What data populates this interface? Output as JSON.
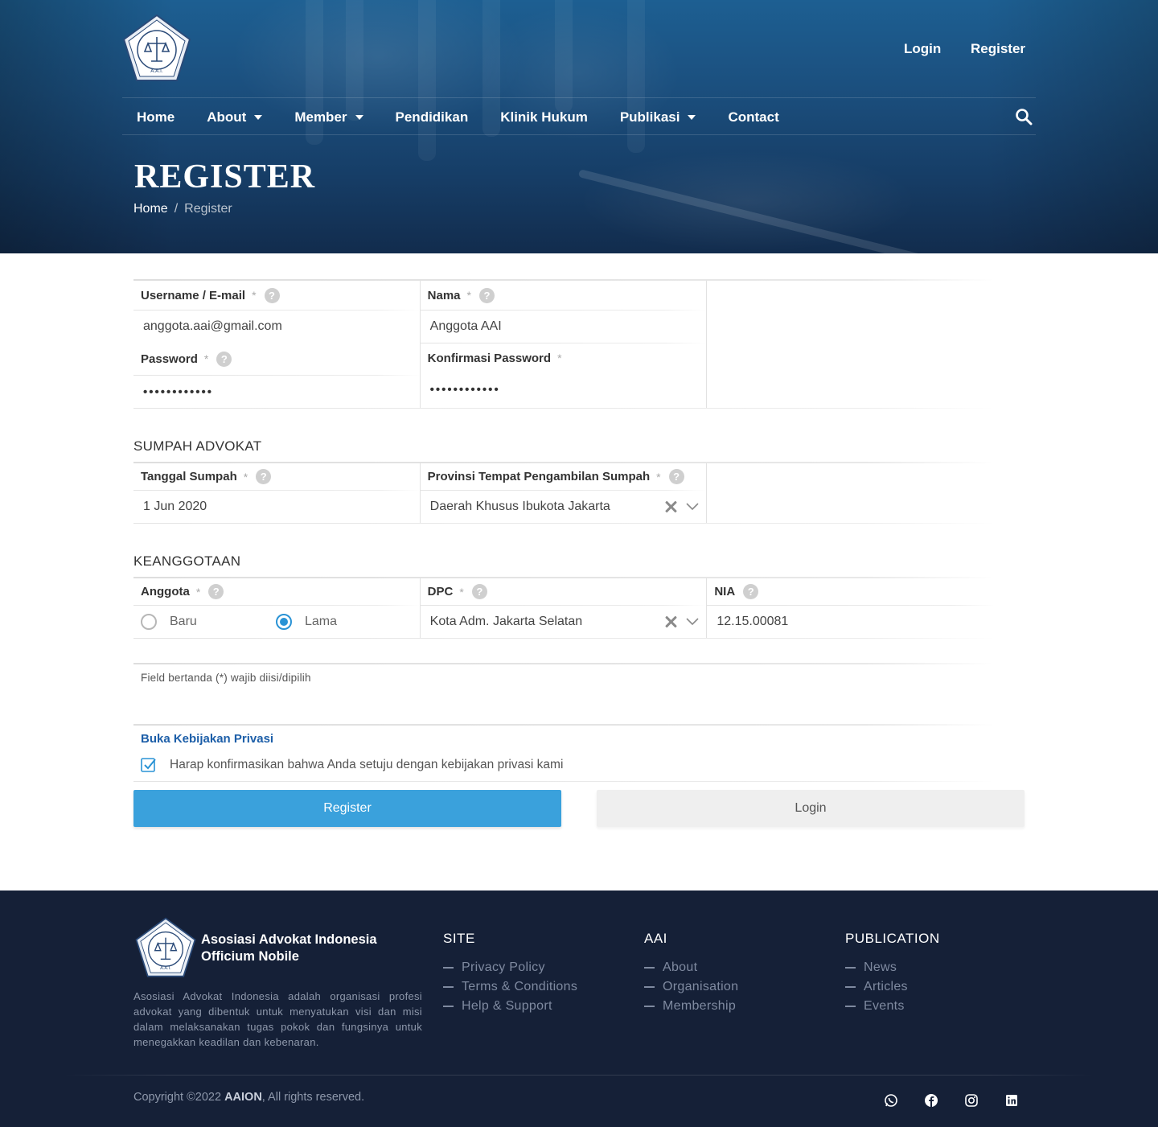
{
  "header": {
    "logo_text_ring": "ASOSIASI ADVOKAT INDONESIA",
    "logo_abbr": "A.A.I.",
    "top_links": {
      "login": "Login",
      "register": "Register"
    },
    "nav": [
      {
        "label": "Home",
        "dropdown": false
      },
      {
        "label": "About",
        "dropdown": true
      },
      {
        "label": "Member",
        "dropdown": true
      },
      {
        "label": "Pendidikan",
        "dropdown": false
      },
      {
        "label": "Klinik Hukum",
        "dropdown": false
      },
      {
        "label": "Publikasi",
        "dropdown": true
      },
      {
        "label": "Contact",
        "dropdown": false
      }
    ],
    "search_icon": "search-icon",
    "page_title": "REGISTER",
    "breadcrumb": {
      "home": "Home",
      "separator": "/",
      "current": "Register"
    }
  },
  "form": {
    "account": {
      "username": {
        "label": "Username / E-mail",
        "required": "*",
        "value": "anggota.aai@gmail.com"
      },
      "nama": {
        "label": "Nama",
        "required": "*",
        "value": "Anggota AAI"
      },
      "password": {
        "label": "Password",
        "required": "*",
        "value": "••••••••••••"
      },
      "konfirmasi": {
        "label": "Konfirmasi Password",
        "required": "*",
        "value": "••••••••••••"
      }
    },
    "sumpah": {
      "title": "SUMPAH ADVOKAT",
      "tanggal": {
        "label": "Tanggal Sumpah",
        "required": "*",
        "value": "1 Jun 2020"
      },
      "provinsi": {
        "label": "Provinsi Tempat Pengambilan Sumpah",
        "required": "*",
        "value": "Daerah Khusus Ibukota Jakarta"
      }
    },
    "keanggotaan": {
      "title": "KEANGGOTAAN",
      "anggota": {
        "label": "Anggota",
        "required": "*",
        "options": [
          "Baru",
          "Lama"
        ],
        "selected": "Lama"
      },
      "dpc": {
        "label": "DPC",
        "required": "*",
        "value": "Kota Adm. Jakarta Selatan"
      },
      "nia": {
        "label": "NIA",
        "value": "12.15.00081"
      }
    },
    "help_glyph": "?",
    "required_note": "Field bertanda (*) wajib diisi/dipilih",
    "privacy": {
      "link": "Buka Kebijakan Privasi",
      "consent": "Harap konfirmasikan bahwa Anda setuju dengan kebijakan privasi kami",
      "checked": true
    },
    "buttons": {
      "register": "Register",
      "login": "Login"
    }
  },
  "footer": {
    "brand_line1": "Asosiasi Advokat Indonesia",
    "brand_line2": "Officium Nobile",
    "about": "Asosiasi Advokat Indonesia adalah organisasi profesi advokat yang dibentuk untuk menyatukan visi dan misi dalam melaksanakan tugas pokok dan fungsinya untuk menegakkan keadilan dan kebenaran.",
    "columns": [
      {
        "title": "SITE",
        "links": [
          "Privacy Policy",
          "Terms & Conditions",
          "Help & Support"
        ]
      },
      {
        "title": "AAI",
        "links": [
          "About",
          "Organisation",
          "Membership"
        ]
      },
      {
        "title": "PUBLICATION",
        "links": [
          "News",
          "Articles",
          "Events"
        ]
      }
    ],
    "copyright_prefix": "Copyright ©2022 ",
    "copyright_brand": "AAION",
    "copyright_suffix": ", All rights reserved.",
    "social": [
      "whatsapp-icon",
      "facebook-icon",
      "instagram-icon",
      "linkedin-icon"
    ]
  },
  "colors": {
    "hero_blue": "#1b4f7e",
    "primary_button": "#3aa1dc",
    "link_blue": "#1c5ea8",
    "footer_bg": "#152037"
  }
}
